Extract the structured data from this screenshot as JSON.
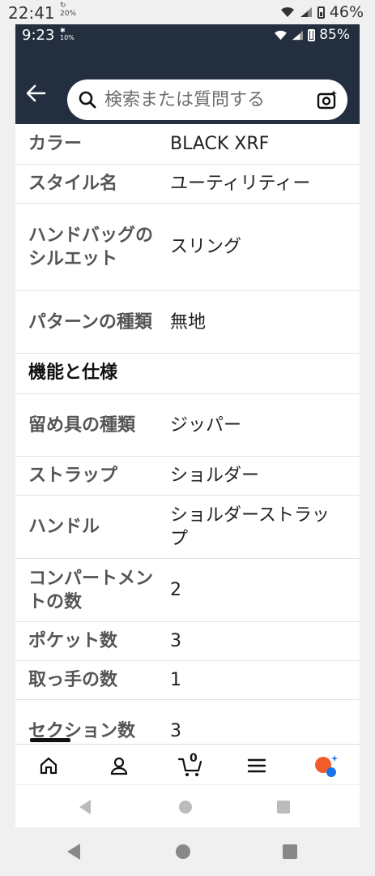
{
  "outer_status": {
    "time": "22:41",
    "notif_top": "↻",
    "notif_bottom": "20%",
    "battery": "46%"
  },
  "inner_status": {
    "time": "9:23",
    "notif_small": "10%",
    "battery": "85%"
  },
  "search": {
    "placeholder": "検索または質問する"
  },
  "specs": [
    {
      "key": "カラー",
      "value": "BLACK XRF"
    },
    {
      "key": "スタイル名",
      "value": "ユーティリティー"
    },
    {
      "key": "ハンドバッグのシルエット",
      "value": "スリング"
    },
    {
      "key": "パターンの種類",
      "value": "無地"
    },
    {
      "section": "機能と仕様"
    },
    {
      "key": "留め具の種類",
      "value": "ジッパー"
    },
    {
      "key": "ストラップ",
      "value": "ショルダー"
    },
    {
      "key": "ハンドル",
      "value": "ショルダーストラップ"
    },
    {
      "key": "コンパートメントの数",
      "value": "2"
    },
    {
      "key": "ポケット数",
      "value": "3"
    },
    {
      "key": "取っ手の数",
      "value": "1"
    },
    {
      "key": "セクション数",
      "value": "3"
    }
  ],
  "bottom_nav": {
    "home_icon": "home-icon",
    "account_icon": "person-icon",
    "cart_icon": "cart-icon",
    "cart_count": "0",
    "menu_icon": "menu-icon",
    "assistant_icon": "rufus-icon"
  },
  "colors": {
    "header_bg": "#232f3e",
    "accent": "#f25c2a",
    "assistant_blue": "#1a73e8"
  }
}
